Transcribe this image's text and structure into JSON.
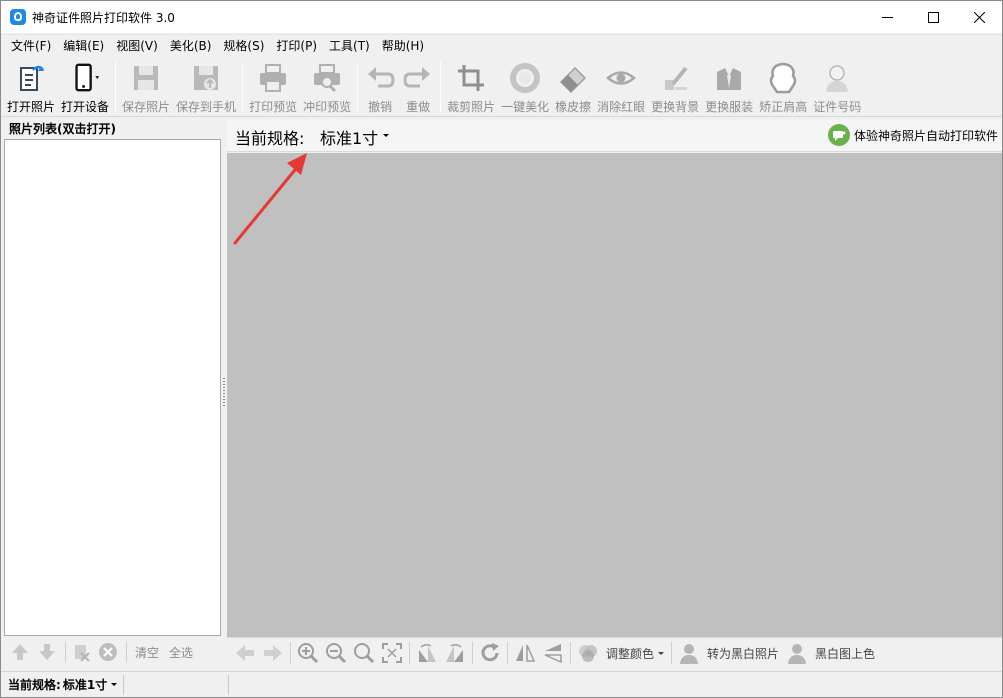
{
  "window": {
    "title": "神奇证件照片打印软件 3.0",
    "controls": [
      "minimize-icon",
      "maximize-icon",
      "close-icon"
    ]
  },
  "menu": [
    {
      "label": "文件(F)"
    },
    {
      "label": "编辑(E)"
    },
    {
      "label": "视图(V)"
    },
    {
      "label": "美化(B)"
    },
    {
      "label": "规格(S)"
    },
    {
      "label": "打印(P)"
    },
    {
      "label": "工具(T)"
    },
    {
      "label": "帮助(H)"
    }
  ],
  "toolbar": {
    "buttons": [
      {
        "label": "打开照片",
        "icon": "open-photo-icon",
        "enabled": true
      },
      {
        "label": "打开设备",
        "icon": "phone-device-icon",
        "enabled": true
      },
      {
        "label": "保存照片",
        "icon": "save-icon",
        "enabled": false
      },
      {
        "label": "保存到手机",
        "icon": "save-to-phone-icon",
        "enabled": false
      },
      {
        "label": "打印预览",
        "icon": "printer-icon",
        "enabled": false
      },
      {
        "label": "冲印预览",
        "icon": "print-preview-icon",
        "enabled": false
      },
      {
        "label": "撤销",
        "icon": "undo-icon",
        "enabled": false
      },
      {
        "label": "重做",
        "icon": "redo-icon",
        "enabled": false
      },
      {
        "label": "裁剪照片",
        "icon": "crop-icon",
        "enabled": false
      },
      {
        "label": "一键美化",
        "icon": "beautify-icon",
        "enabled": false
      },
      {
        "label": "橡皮擦",
        "icon": "eraser-icon",
        "enabled": false
      },
      {
        "label": "消除红眼",
        "icon": "eye-icon",
        "enabled": false
      },
      {
        "label": "更换背景",
        "icon": "background-icon",
        "enabled": false
      },
      {
        "label": "更换服装",
        "icon": "suit-icon",
        "enabled": false
      },
      {
        "label": "矫正肩高",
        "icon": "shoulder-icon",
        "enabled": false
      },
      {
        "label": "证件号码",
        "icon": "id-person-icon",
        "enabled": false
      }
    ]
  },
  "left_panel": {
    "header": "照片列表(双击打开)",
    "actions": {
      "clear": "清空",
      "select_all": "全选"
    }
  },
  "spec_bar": {
    "label": "当前规格:",
    "value": "标准1寸",
    "promo": "体验神奇照片自动打印软件"
  },
  "bottom_toolbar": {
    "adjust_color": "调整颜色",
    "to_bw": "转为黑白照片",
    "colorize": "黑白图上色"
  },
  "status_bar": {
    "label": "当前规格:",
    "value": "标准1寸"
  },
  "colors": {
    "canvas_bg": "#c0c0c0",
    "annotation_arrow": "#e53935",
    "app_icon": "#1e88e5",
    "promo_icon": "#6ab04c"
  }
}
